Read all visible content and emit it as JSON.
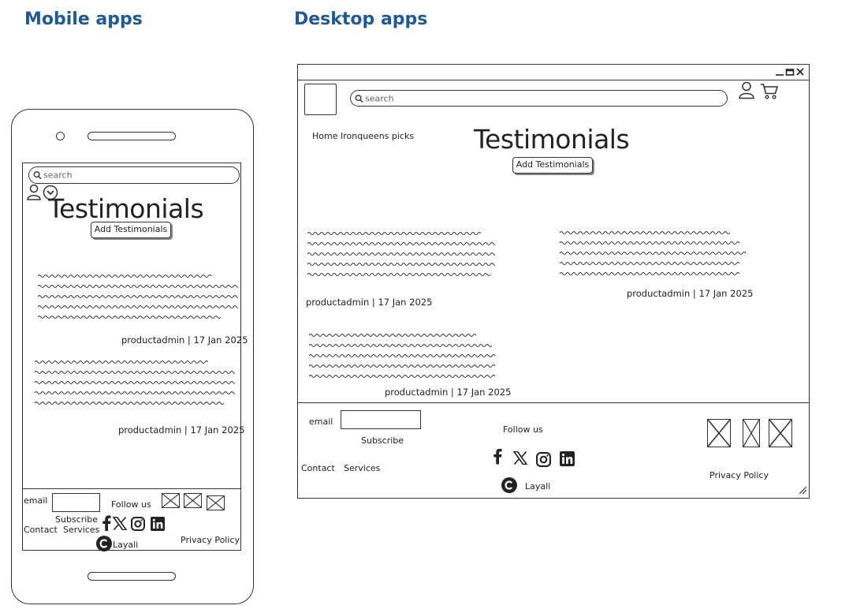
{
  "headings": {
    "mobile": "Mobile apps",
    "desktop": "Desktop apps"
  },
  "search": {
    "placeholder": "search"
  },
  "page": {
    "title": "Testimonials",
    "add_button": "Add Testimonials"
  },
  "desktop": {
    "window_controls": [
      "minimize",
      "maximize",
      "close"
    ],
    "nav": "Home Ironqueens picks",
    "testimonials": [
      {
        "author": "productadmin | 17 Jan 2025"
      },
      {
        "author": "productadmin | 17 Jan 2025"
      },
      {
        "author": "productadmin | 17 Jan 2025"
      }
    ]
  },
  "mobile": {
    "testimonials": [
      {
        "author": "productadmin | 17 Jan 2025"
      },
      {
        "author": "productadmin | 17 Jan 2025"
      }
    ]
  },
  "footer": {
    "email_label": "email",
    "subscribe": "Subscribe",
    "follow_us": "Follow us",
    "contact": "Contact",
    "services": "Services",
    "brand": "Layali",
    "privacy": "Privacy Policy",
    "social_icons": [
      "facebook-icon",
      "x-icon",
      "instagram-icon",
      "linkedin-icon"
    ]
  }
}
